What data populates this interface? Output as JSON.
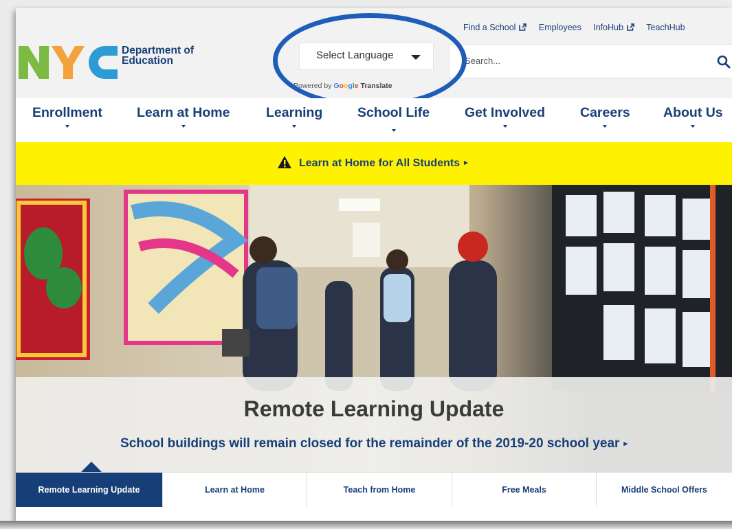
{
  "logo": {
    "line1": "Department of",
    "line2": "Education"
  },
  "translate": {
    "select_label": "Select Language",
    "powered_prefix": "Powered by",
    "google": "Google",
    "translate_word": "Translate"
  },
  "toplinks": [
    "Find a School",
    "Employees",
    "InfoHub",
    "TeachHub"
  ],
  "search": {
    "placeholder": "Search..."
  },
  "nav": [
    "Enrollment",
    "Learn at Home",
    "Learning",
    "School Life",
    "Get Involved",
    "Careers",
    "About Us"
  ],
  "alert": {
    "text": "Learn at Home for All Students"
  },
  "hero": {
    "title": "Remote Learning Update",
    "subtitle": "School buildings will remain closed for the remainder of the 2019-20 school year"
  },
  "tabs": [
    "Remote Learning Update",
    "Learn at Home",
    "Teach from Home",
    "Free Meals",
    "Middle School Offers"
  ],
  "colors": {
    "brand_blue": "#173f77",
    "alert_yellow": "#fff200",
    "annotation_blue": "#1e5db8",
    "logo_green": "#7cba43",
    "logo_orange": "#f3a23b",
    "logo_blue": "#2d9cd6"
  }
}
